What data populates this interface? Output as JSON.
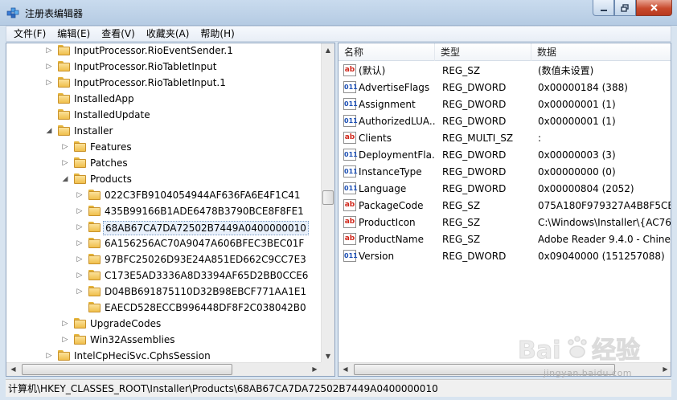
{
  "window": {
    "title": "注册表编辑器"
  },
  "menu": [
    "文件(F)",
    "编辑(E)",
    "查看(V)",
    "收藏夹(A)",
    "帮助(H)"
  ],
  "tree": [
    {
      "label": "InputProcessor.RioEventSender.1",
      "expander": "collapsed",
      "level": 0
    },
    {
      "label": "InputProcessor.RioTabletInput",
      "expander": "collapsed",
      "level": 0
    },
    {
      "label": "InputProcessor.RioTabletInput.1",
      "expander": "collapsed",
      "level": 0
    },
    {
      "label": "InstalledApp",
      "expander": "none",
      "level": 0
    },
    {
      "label": "InstalledUpdate",
      "expander": "none",
      "level": 0
    },
    {
      "label": "Installer",
      "expander": "expanded",
      "level": 0
    },
    {
      "label": "Features",
      "expander": "collapsed",
      "level": 1
    },
    {
      "label": "Patches",
      "expander": "collapsed",
      "level": 1
    },
    {
      "label": "Products",
      "expander": "expanded",
      "level": 1
    },
    {
      "label": "022C3FB9104054944AF636FA6E4F1C41",
      "expander": "collapsed",
      "level": 2
    },
    {
      "label": "435B99166B1ADE6478B3790BCE8F8FE1",
      "expander": "collapsed",
      "level": 2
    },
    {
      "label": "68AB67CA7DA72502B7449A0400000010",
      "expander": "collapsed",
      "level": 2,
      "selected": true
    },
    {
      "label": "6A156256AC70A9047A606BFEC3BEC01F",
      "expander": "collapsed",
      "level": 2
    },
    {
      "label": "97BFC25026D93E24A851ED662C9CC7E3",
      "expander": "collapsed",
      "level": 2
    },
    {
      "label": "C173E5AD3336A8D3394AF65D2BB0CCE6",
      "expander": "collapsed",
      "level": 2
    },
    {
      "label": "D04BB691875110D32B98EBCF771AA1E1",
      "expander": "collapsed",
      "level": 2
    },
    {
      "label": "EAECD528ECCB996448DF8F2C038042B0",
      "expander": "none",
      "level": 2
    },
    {
      "label": "UpgradeCodes",
      "expander": "collapsed",
      "level": 1
    },
    {
      "label": "Win32Assemblies",
      "expander": "collapsed",
      "level": 1
    },
    {
      "label": "IntelCpHeciSvc.CphsSession",
      "expander": "collapsed",
      "level": 0
    }
  ],
  "list": {
    "columns": [
      "名称",
      "类型",
      "数据"
    ],
    "rows": [
      {
        "icon": "string-value-icon",
        "name": "(默认)",
        "type": "REG_SZ",
        "data": "(数值未设置)"
      },
      {
        "icon": "dword-value-icon",
        "name": "AdvertiseFlags",
        "type": "REG_DWORD",
        "data": "0x00000184 (388)"
      },
      {
        "icon": "dword-value-icon",
        "name": "Assignment",
        "type": "REG_DWORD",
        "data": "0x00000001 (1)"
      },
      {
        "icon": "dword-value-icon",
        "name": "AuthorizedLUA...",
        "type": "REG_DWORD",
        "data": "0x00000001 (1)"
      },
      {
        "icon": "string-value-icon",
        "name": "Clients",
        "type": "REG_MULTI_SZ",
        "data": ":"
      },
      {
        "icon": "dword-value-icon",
        "name": "DeploymentFla...",
        "type": "REG_DWORD",
        "data": "0x00000003 (3)"
      },
      {
        "icon": "dword-value-icon",
        "name": "InstanceType",
        "type": "REG_DWORD",
        "data": "0x00000000 (0)"
      },
      {
        "icon": "dword-value-icon",
        "name": "Language",
        "type": "REG_DWORD",
        "data": "0x00000804 (2052)"
      },
      {
        "icon": "string-value-icon",
        "name": "PackageCode",
        "type": "REG_SZ",
        "data": "075A180F979327A4B8F5CE5A"
      },
      {
        "icon": "string-value-icon",
        "name": "ProductIcon",
        "type": "REG_SZ",
        "data": "C:\\Windows\\Installer\\{AC76E"
      },
      {
        "icon": "string-value-icon",
        "name": "ProductName",
        "type": "REG_SZ",
        "data": "Adobe Reader 9.4.0 - Chines"
      },
      {
        "icon": "dword-value-icon",
        "name": "Version",
        "type": "REG_DWORD",
        "data": "0x09040000 (151257088)"
      }
    ]
  },
  "status": "计算机\\HKEY_CLASSES_ROOT\\Installer\\Products\\68AB67CA7DA72502B7449A0400000010",
  "watermark": {
    "logo": "Bai du 经验",
    "url": "jingyan.baidu.com"
  }
}
